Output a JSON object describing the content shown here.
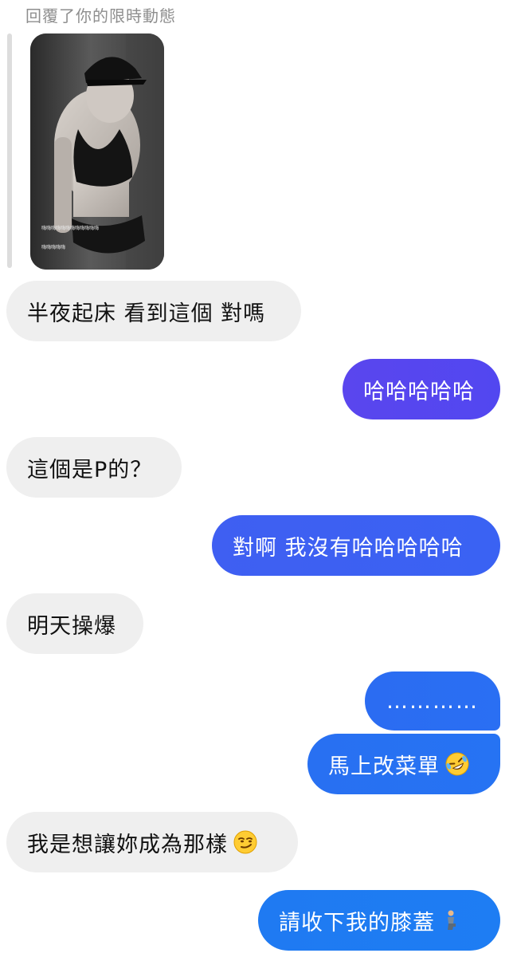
{
  "reply_header": "回覆了你的限時動態",
  "story": {
    "caption_line1": "嗨嗨嗨嗨嗨嗨嗨嗨嗨嗨嗨嗨",
    "caption_line2": "嗨嗨嗨嗨嗨"
  },
  "messages": [
    {
      "side": "in",
      "text": "半夜起床 看到這個 對嗎"
    },
    {
      "side": "out",
      "text": "哈哈哈哈哈"
    },
    {
      "side": "in",
      "text": "這個是P的？"
    },
    {
      "side": "out",
      "text": "對啊 我沒有哈哈哈哈哈"
    },
    {
      "side": "in",
      "text": "明天操爆"
    },
    {
      "side": "out",
      "text": "…………"
    },
    {
      "side": "out",
      "text": "馬上改菜單",
      "icon": "rofl-emoji-icon"
    },
    {
      "side": "in",
      "text": "我是想讓妳成為那樣",
      "icon": "smirk-emoji-icon"
    },
    {
      "side": "out",
      "text": "請收下我的膝蓋",
      "icon": "kneeling-person-icon"
    }
  ],
  "colors": {
    "incoming_bubble": "#efefef",
    "outgoing_gradient_purple": "#5b45f0",
    "outgoing_gradient_blue": "#1f7af2",
    "header_text": "#8e8e8e"
  }
}
